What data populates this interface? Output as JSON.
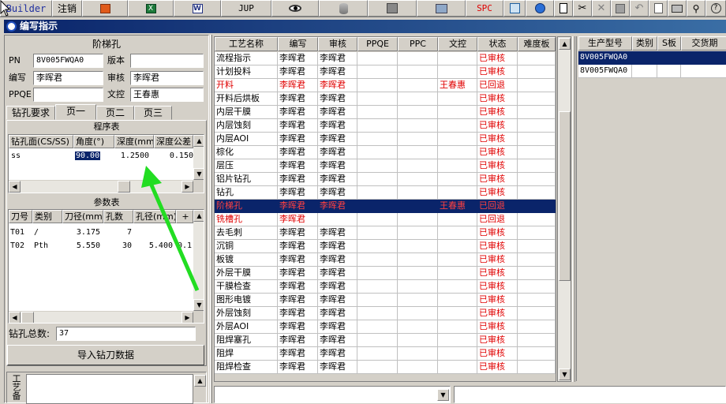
{
  "toolbar": {
    "builder_label": "Builder",
    "items": [
      {
        "label": "注销",
        "icon": "logout"
      },
      {
        "label": "",
        "icon": "powerpoint-icon"
      },
      {
        "label": "",
        "icon": "excel-icon"
      },
      {
        "label": "",
        "icon": "word-icon"
      },
      {
        "label": "JUP",
        "icon": "jump"
      },
      {
        "label": "",
        "icon": "eye-icon"
      },
      {
        "label": "",
        "icon": "database-icon"
      },
      {
        "label": "",
        "icon": "network-icon"
      },
      {
        "label": "",
        "icon": "computer-icon"
      },
      {
        "label": "SPC",
        "icon": "spc"
      },
      {
        "label": "",
        "icon": "document-view-icon"
      },
      {
        "label": "",
        "icon": "ie-icon"
      }
    ],
    "small_icons": [
      "new-icon",
      "cut-icon",
      "close-icon",
      "save-icon",
      "undo-icon",
      "preview-icon",
      "print-icon",
      "binoculars-icon",
      "help-icon"
    ]
  },
  "window": {
    "title": "编写指示"
  },
  "left": {
    "section_title": "阶梯孔",
    "pn_label": "PN",
    "pn_value": "8V005FWQA0",
    "version_label": "版本",
    "version_value": "",
    "author_label": "编写",
    "author_value": "李晖君",
    "reviewer_label": "审核",
    "reviewer_value": "李晖君",
    "ppqe_label": "PPQE",
    "ppqe_value": "",
    "doc_label": "文控",
    "doc_value": "王春惠",
    "tabs": [
      "钻孔要求",
      "页一",
      "页二",
      "页三"
    ],
    "active_tab": 1,
    "program_table": {
      "title": "程序表",
      "headers": [
        "钻孔面(CS/SS)",
        "角度(°)",
        "深度(mm)",
        "深度公差"
      ],
      "rows": [
        [
          "ss",
          "90.00",
          "1.2500",
          "0.150"
        ]
      ]
    },
    "param_table": {
      "title": "参数表",
      "headers": [
        "刀号",
        "类别",
        "刀径(mm)",
        "孔数",
        "孔径(mm)",
        "+"
      ],
      "rows": [
        [
          "T01",
          "/",
          "3.175",
          "7",
          "",
          ""
        ],
        [
          "T02",
          "Pth",
          "5.550",
          "30",
          "5.400",
          "0.1"
        ]
      ]
    },
    "total_label": "钻孔总数:",
    "total_value": "37",
    "import_button": "导入钻刀数据",
    "notes_label": "工艺备"
  },
  "grid": {
    "headers": [
      "工艺名称",
      "编写",
      "审核",
      "PPQE",
      "PPC",
      "文控",
      "状态",
      "难度板"
    ],
    "selected_row": 12,
    "rows": [
      {
        "name": "流程指示",
        "author": "李晖君",
        "reviewer": "李晖君",
        "ppqe": "",
        "ppc": "",
        "doc": "",
        "status": "已审核",
        "red": false
      },
      {
        "name": "计划投料",
        "author": "李晖君",
        "reviewer": "李晖君",
        "ppqe": "",
        "ppc": "",
        "doc": "",
        "status": "已审核",
        "red": false
      },
      {
        "name": "开料",
        "author": "李晖君",
        "reviewer": "李晖君",
        "ppqe": "",
        "ppc": "",
        "doc": "王春惠",
        "status": "已回退",
        "red": true
      },
      {
        "name": "开料后烘板",
        "author": "李晖君",
        "reviewer": "李晖君",
        "ppqe": "",
        "ppc": "",
        "doc": "",
        "status": "已审核",
        "red": false
      },
      {
        "name": "内层干膜",
        "author": "李晖君",
        "reviewer": "李晖君",
        "ppqe": "",
        "ppc": "",
        "doc": "",
        "status": "已审核",
        "red": false
      },
      {
        "name": "内层蚀刻",
        "author": "李晖君",
        "reviewer": "李晖君",
        "ppqe": "",
        "ppc": "",
        "doc": "",
        "status": "已审核",
        "red": false
      },
      {
        "name": "内层AOI",
        "author": "李晖君",
        "reviewer": "李晖君",
        "ppqe": "",
        "ppc": "",
        "doc": "",
        "status": "已审核",
        "red": false
      },
      {
        "name": "棕化",
        "author": "李晖君",
        "reviewer": "李晖君",
        "ppqe": "",
        "ppc": "",
        "doc": "",
        "status": "已审核",
        "red": false
      },
      {
        "name": "层压",
        "author": "李晖君",
        "reviewer": "李晖君",
        "ppqe": "",
        "ppc": "",
        "doc": "",
        "status": "已审核",
        "red": false
      },
      {
        "name": "铝片钻孔",
        "author": "李晖君",
        "reviewer": "李晖君",
        "ppqe": "",
        "ppc": "",
        "doc": "",
        "status": "已审核",
        "red": false
      },
      {
        "name": "钻孔",
        "author": "李晖君",
        "reviewer": "李晖君",
        "ppqe": "",
        "ppc": "",
        "doc": "",
        "status": "已审核",
        "red": false
      },
      {
        "name": "阶梯孔",
        "author": "李晖君",
        "reviewer": "李晖君",
        "ppqe": "",
        "ppc": "",
        "doc": "王春惠",
        "status": "已回退",
        "red": true
      },
      {
        "name": "铣槽孔",
        "author": "李晖君",
        "reviewer": "",
        "ppqe": "",
        "ppc": "",
        "doc": "",
        "status": "已回退",
        "red": true
      },
      {
        "name": "去毛刺",
        "author": "李晖君",
        "reviewer": "李晖君",
        "ppqe": "",
        "ppc": "",
        "doc": "",
        "status": "已审核",
        "red": false
      },
      {
        "name": "沉铜",
        "author": "李晖君",
        "reviewer": "李晖君",
        "ppqe": "",
        "ppc": "",
        "doc": "",
        "status": "已审核",
        "red": false
      },
      {
        "name": "板镀",
        "author": "李晖君",
        "reviewer": "李晖君",
        "ppqe": "",
        "ppc": "",
        "doc": "",
        "status": "已审核",
        "red": false
      },
      {
        "name": "外层干膜",
        "author": "李晖君",
        "reviewer": "李晖君",
        "ppqe": "",
        "ppc": "",
        "doc": "",
        "status": "已审核",
        "red": false
      },
      {
        "name": "干膜检查",
        "author": "李晖君",
        "reviewer": "李晖君",
        "ppqe": "",
        "ppc": "",
        "doc": "",
        "status": "已审核",
        "red": false
      },
      {
        "name": "图形电镀",
        "author": "李晖君",
        "reviewer": "李晖君",
        "ppqe": "",
        "ppc": "",
        "doc": "",
        "status": "已审核",
        "red": false
      },
      {
        "name": "外层蚀刻",
        "author": "李晖君",
        "reviewer": "李晖君",
        "ppqe": "",
        "ppc": "",
        "doc": "",
        "status": "已审核",
        "red": false
      },
      {
        "name": "外层AOI",
        "author": "李晖君",
        "reviewer": "李晖君",
        "ppqe": "",
        "ppc": "",
        "doc": "",
        "status": "已审核",
        "red": false
      },
      {
        "name": "阻焊塞孔",
        "author": "李晖君",
        "reviewer": "李晖君",
        "ppqe": "",
        "ppc": "",
        "doc": "",
        "status": "已审核",
        "red": false
      },
      {
        "name": "阻焊",
        "author": "李晖君",
        "reviewer": "李晖君",
        "ppqe": "",
        "ppc": "",
        "doc": "",
        "status": "已审核",
        "red": false
      },
      {
        "name": "阻焊检查",
        "author": "李晖君",
        "reviewer": "李晖君",
        "ppqe": "",
        "ppc": "",
        "doc": "",
        "status": "已审核",
        "red": false
      }
    ]
  },
  "right_grid": {
    "headers": [
      "生产型号",
      "类别",
      "S板",
      "交货期"
    ],
    "rows": [
      [
        "8V005FWQA0",
        "",
        "",
        ""
      ],
      [
        "8V005FWQA0",
        "",
        "",
        ""
      ]
    ],
    "selected_row": 0
  },
  "colors": {
    "selection": "#0a246a",
    "red_text": "#e00000",
    "arrow": "#22dd22",
    "title_start": "#0a246a",
    "title_end": "#3a6ea5"
  }
}
